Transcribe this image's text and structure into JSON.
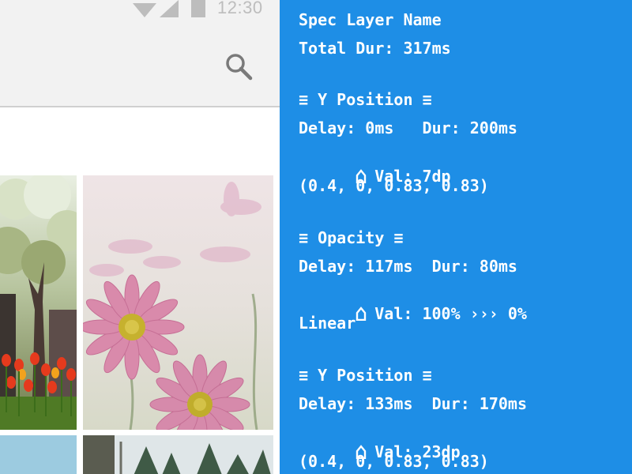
{
  "status_bar": {
    "time": "12:30",
    "icons": [
      "wifi-icon",
      "signal-icon",
      "battery-icon"
    ]
  },
  "app_bar": {
    "icon": "search-icon"
  },
  "gallery": {
    "tiles": [
      {
        "name": "tree-tulips-photo"
      },
      {
        "name": "pink-daisies-photo"
      },
      {
        "name": "blue-sky-photo"
      },
      {
        "name": "pine-forest-photo"
      }
    ]
  },
  "spec": {
    "layer_name": "Spec Layer Name",
    "total_dur": "Total Dur: 317ms",
    "blocks": [
      {
        "title": "≡ Y Position ≡",
        "timing": "Delay: 0ms   Dur: 200ms",
        "val": "Val: 7dp",
        "easing": "(0.4, 0, 0.83, 0.83)"
      },
      {
        "title": "≡ Opacity ≡",
        "timing": "Delay: 117ms  Dur: 80ms",
        "val": "Val: 100% ››› 0%",
        "easing": "Linear"
      },
      {
        "title": "≡ Y Position ≡",
        "timing": "Delay: 133ms  Dur: 170ms",
        "val": "Val: 23dp",
        "easing": "(0.4, 0, 0.83, 0.83)"
      }
    ]
  },
  "colors": {
    "panel_bg": "#1e8ee6",
    "panel_text": "#ffffff",
    "app_bar_bg": "#f2f2f2",
    "status_icon": "#bdbdbd"
  }
}
